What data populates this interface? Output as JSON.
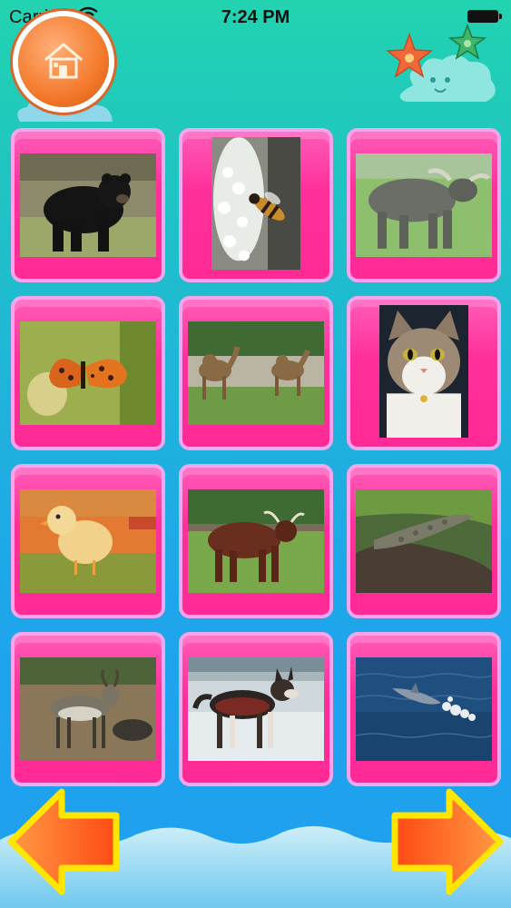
{
  "status_bar": {
    "carrier": "Carrier",
    "time": "7:24 PM"
  },
  "navigation": {
    "home": "home-icon",
    "previous": "left-arrow-icon",
    "next": "right-arrow-icon"
  },
  "colors": {
    "tile_pink": "#ff2f9a",
    "tile_border": "#f2a6ee",
    "home_orange": "#f47a2c",
    "arrow_yellow": "#ffe600",
    "arrow_orange": "#ff5a1a"
  },
  "tiles": [
    {
      "animal": "bear"
    },
    {
      "animal": "bee"
    },
    {
      "animal": "buffalo"
    },
    {
      "animal": "butterfly"
    },
    {
      "animal": "camel"
    },
    {
      "animal": "cat"
    },
    {
      "animal": "chick"
    },
    {
      "animal": "cow"
    },
    {
      "animal": "crocodile"
    },
    {
      "animal": "deer"
    },
    {
      "animal": "dog"
    },
    {
      "animal": "dolphin"
    }
  ]
}
